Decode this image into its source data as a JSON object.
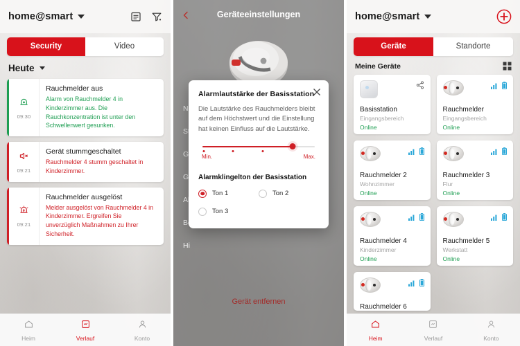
{
  "panel1": {
    "header": {
      "home_label": "home@smart",
      "icons": [
        "calendar-list-icon",
        "filter-icon"
      ]
    },
    "tabs": [
      {
        "label": "Security",
        "active": true
      },
      {
        "label": "Video",
        "active": false
      }
    ],
    "section_title": "Heute",
    "events": [
      {
        "time": "09:30",
        "title": "Rauchmelder aus",
        "desc": "Alarm von Rauchmelder 4 in Kinderzimmer aus. Die Rauchkonzentration ist unter den Schwellenwert gesunken.",
        "accent": "#1e9e52",
        "icon": "alarm-off-icon",
        "tone": "green"
      },
      {
        "time": "09:21",
        "title": "Gerät stummgeschaltet",
        "desc": "Rauchmelder 4 stumm geschaltet in Kinderzimmer.",
        "accent": "#cf1f26",
        "icon": "speaker-mute-icon",
        "tone": "red"
      },
      {
        "time": "09:21",
        "title": "Rauchmelder ausgelöst",
        "desc": "Melder ausgelöst von Rauchmelder 4 in Kinderzimmer. Ergreifen Sie unverzüglich Maßnahmen zu Ihrer Sicherheit.",
        "accent": "#cf1f26",
        "icon": "alarm-triggered-icon",
        "tone": "red"
      }
    ],
    "bottom_nav": [
      {
        "label": "Heim",
        "icon": "home-icon",
        "active": false
      },
      {
        "label": "Verlauf",
        "icon": "history-icon",
        "active": true
      },
      {
        "label": "Konto",
        "icon": "account-icon",
        "active": false
      }
    ]
  },
  "panel2": {
    "header": {
      "title": "Geräteeinstellungen",
      "back_icon": "back-chevron-icon"
    },
    "device_image": "smoke-detector-image",
    "settings_rows": [
      "N",
      "St",
      "Ge",
      "Ge",
      "Al",
      "Be",
      "Hi"
    ],
    "remove_label": "Gerät entfernen",
    "modal": {
      "close_icon": "close-icon",
      "title": "Alarmlautstärke der Basisstation",
      "description": "Die Lautstärke des Rauchmelders bleibt auf dem Höchstwert und die Einstellung hat keinen Einfluss auf die Lautstärke.",
      "slider": {
        "min_label": "Min.",
        "max_label": "Max.",
        "value_percent": 80,
        "tick_percents": [
          0,
          27,
          54,
          80
        ]
      },
      "ringtone_title": "Alarmklingelton der Basisstation",
      "options": [
        {
          "label": "Ton 1",
          "selected": true
        },
        {
          "label": "Ton 2",
          "selected": false
        },
        {
          "label": "Ton 3",
          "selected": false
        }
      ]
    }
  },
  "panel3": {
    "header": {
      "home_label": "home@smart",
      "add_icon": "plus-circle-icon"
    },
    "tabs": [
      {
        "label": "Geräte",
        "active": true
      },
      {
        "label": "Standorte",
        "active": false
      }
    ],
    "section_title": "Meine Geräte",
    "view_toggle_icon": "grid-view-icon",
    "devices": [
      {
        "name": "Basisstation",
        "room": "Eingangsbereich",
        "status": "Online",
        "icon": "base-station-icon",
        "badges": [
          "share-icon"
        ]
      },
      {
        "name": "Rauchmelder",
        "room": "Eingangsbereich",
        "status": "Online",
        "icon": "smoke-detector-icon",
        "badges": [
          "signal-icon",
          "battery-icon"
        ]
      },
      {
        "name": "Rauchmelder 2",
        "room": "Wohnzimmer",
        "status": "Online",
        "icon": "smoke-detector-icon",
        "badges": [
          "signal-icon",
          "battery-icon"
        ]
      },
      {
        "name": "Rauchmelder 3",
        "room": "Flur",
        "status": "Online",
        "icon": "smoke-detector-icon",
        "badges": [
          "signal-icon",
          "battery-icon"
        ]
      },
      {
        "name": "Rauchmelder 4",
        "room": "Kinderzimmer",
        "status": "Online",
        "icon": "smoke-detector-icon",
        "badges": [
          "signal-icon",
          "battery-icon"
        ]
      },
      {
        "name": "Rauchmelder 5",
        "room": "Werkstatt",
        "status": "Online",
        "icon": "smoke-detector-icon",
        "badges": [
          "signal-icon",
          "battery-icon"
        ]
      },
      {
        "name": "Rauchmelder 6",
        "room": "",
        "status": "",
        "icon": "smoke-detector-icon",
        "badges": [
          "signal-icon",
          "battery-icon"
        ]
      }
    ],
    "bottom_nav": [
      {
        "label": "Heim",
        "icon": "home-icon",
        "active": true
      },
      {
        "label": "Verlauf",
        "icon": "history-icon",
        "active": false
      },
      {
        "label": "Konto",
        "icon": "account-icon",
        "active": false
      }
    ]
  },
  "colors": {
    "accent_red": "#d8121b",
    "status_green": "#1e9e52",
    "alert_red": "#cf1f26",
    "badge_blue": "#2aa7d8"
  }
}
